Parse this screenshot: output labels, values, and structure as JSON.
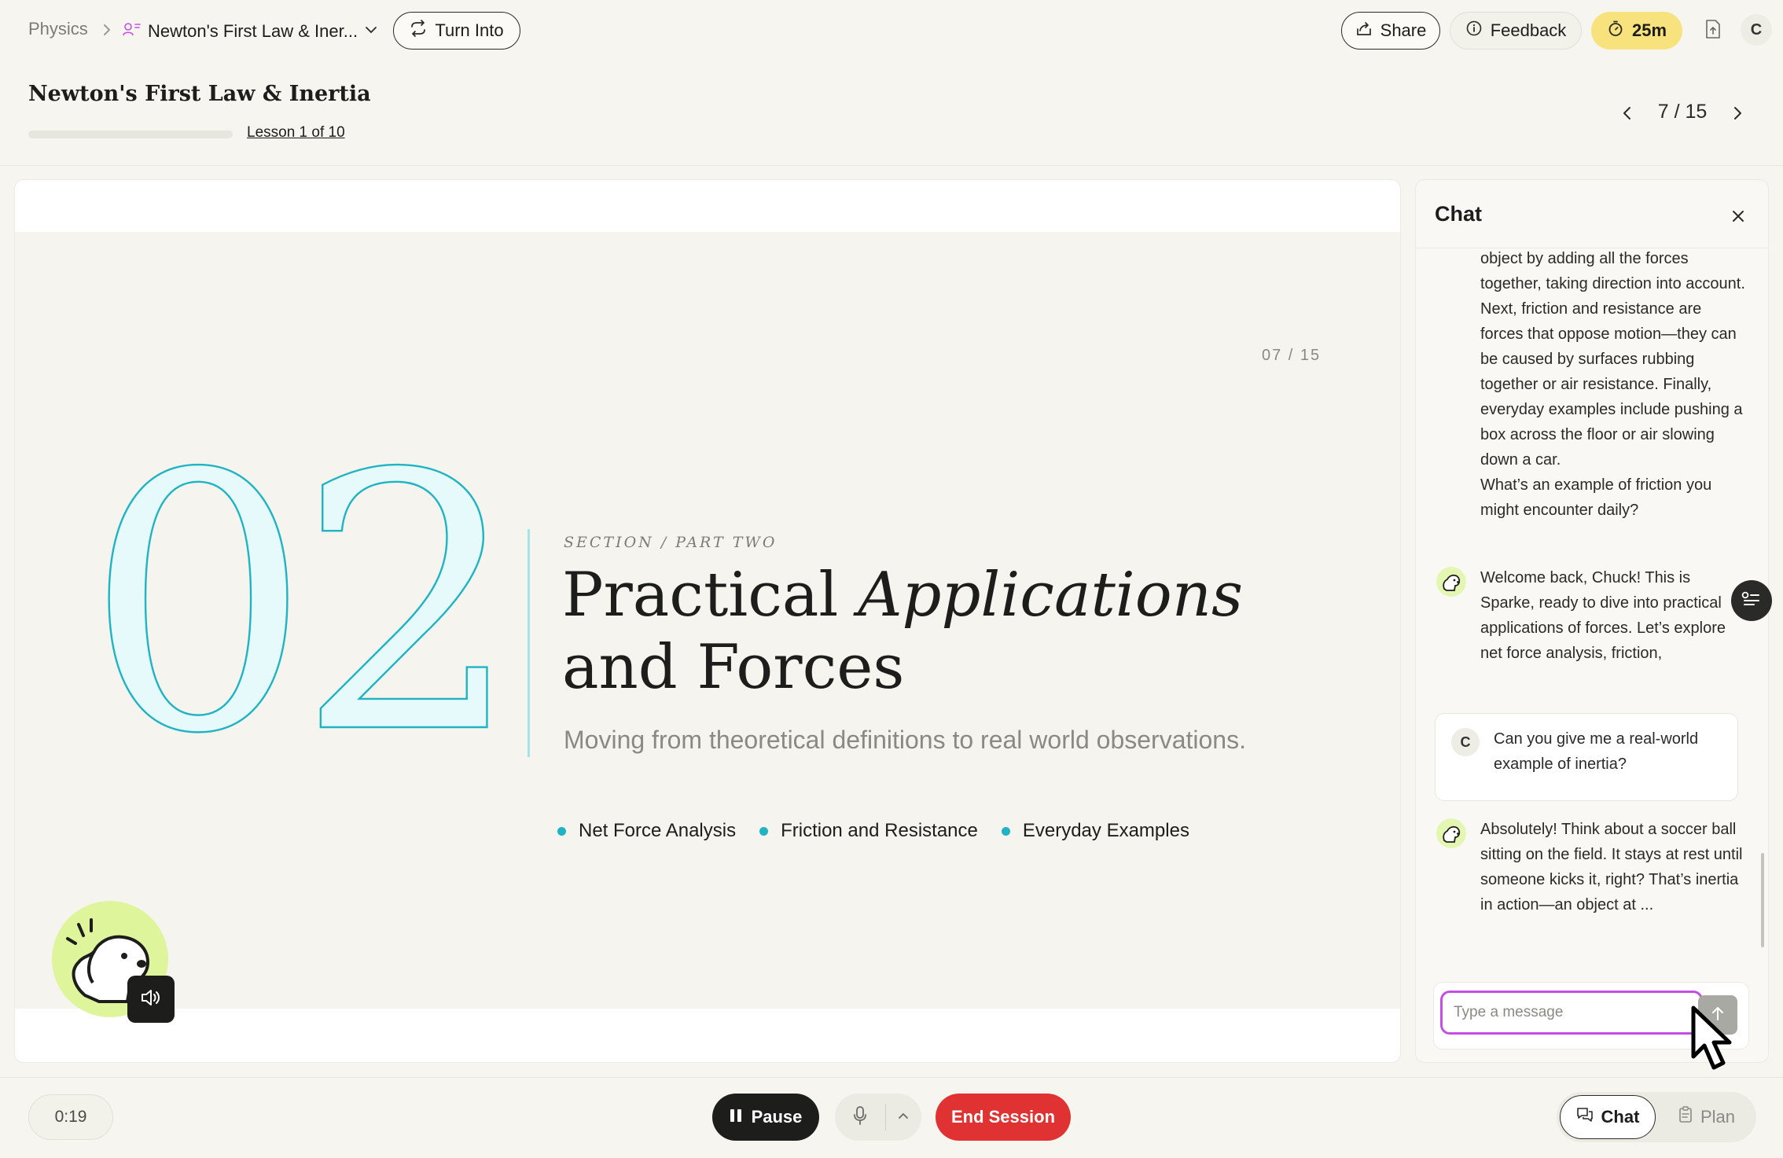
{
  "breadcrumb": {
    "root": "Physics",
    "course": "Newton's First Law & Iner..."
  },
  "header": {
    "turn_into": "Turn Into",
    "share": "Share",
    "feedback": "Feedback",
    "timer": "25m",
    "user_initial": "C"
  },
  "lesson": {
    "title": "Newton's First Law & Inertia",
    "lesson_link": "Lesson 1 of 10",
    "progress_fraction": 0.0,
    "slide_counter": "7 / 15"
  },
  "slide": {
    "number": "07 / 15",
    "big_number": "02",
    "section_label": "SECTION / PART TWO",
    "headline_part1": "Practical ",
    "headline_italic": "Applications",
    "headline_part2": "and Forces",
    "subhead": "Moving from theoretical definitions to real world observations.",
    "bullets": [
      "Net Force Analysis",
      "Friction and Resistance",
      "Everyday Examples"
    ]
  },
  "chat": {
    "title": "Chat",
    "messages": [
      {
        "role": "assistant",
        "text": "object by adding all the forces together, taking direction into account. Next, friction and resistance are forces that oppose motion—they can be caused by surfaces rubbing together or air resistance. Finally, everyday examples include pushing a box across the floor or air slowing down a car.\nWhat’s an example of friction you might encounter daily?"
      },
      {
        "role": "assistant",
        "text": "Welcome back, Chuck! This is Sparke, ready to dive into practical applications of forces. Let’s explore net force analysis, friction,"
      },
      {
        "role": "user",
        "initial": "C",
        "text": "Can you give me a real-world example of inertia?"
      },
      {
        "role": "assistant",
        "text": "Absolutely! Think about a soccer ball sitting on the field. It stays at rest until someone kicks it, right? That’s inertia in action—an object at ..."
      }
    ],
    "input_placeholder": "Type a message"
  },
  "bottom": {
    "elapsed": "0:19",
    "pause": "Pause",
    "end_session": "End Session",
    "chat_tab": "Chat",
    "plan_tab": "Plan"
  },
  "colors": {
    "accent_teal": "#1fb3c3",
    "timer_yellow": "#f7e27d",
    "end_red": "#e03232",
    "input_focus": "#c44fe6",
    "mascot_green": "#dff59c"
  }
}
